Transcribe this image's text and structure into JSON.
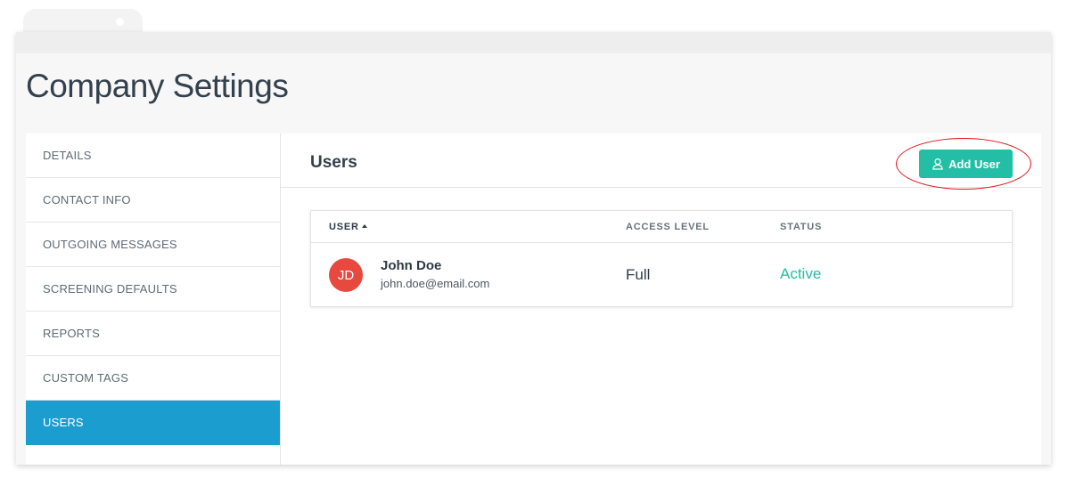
{
  "page": {
    "title": "Company Settings"
  },
  "sidebar": {
    "items": [
      {
        "label": "DETAILS"
      },
      {
        "label": "CONTACT INFO"
      },
      {
        "label": "OUTGOING MESSAGES"
      },
      {
        "label": "SCREENING DEFAULTS"
      },
      {
        "label": "REPORTS"
      },
      {
        "label": "CUSTOM TAGS"
      },
      {
        "label": "USERS",
        "active": true
      }
    ]
  },
  "main": {
    "title": "Users",
    "add_user_label": "Add User",
    "add_user_icon": "user-icon",
    "table": {
      "columns": [
        "USER",
        "ACCESS LEVEL",
        "STATUS"
      ],
      "sort_column": "USER",
      "sort_direction": "ascending",
      "rows": [
        {
          "initials": "JD",
          "name": "John Doe",
          "email": "john.doe@email.com",
          "access_level": "Full",
          "status": "Active"
        }
      ]
    }
  },
  "colors": {
    "accent": "#1c9dd0",
    "button": "#23bea5",
    "status_active": "#23bea5",
    "avatar": "#e8493f",
    "highlight": "#e0141e"
  }
}
